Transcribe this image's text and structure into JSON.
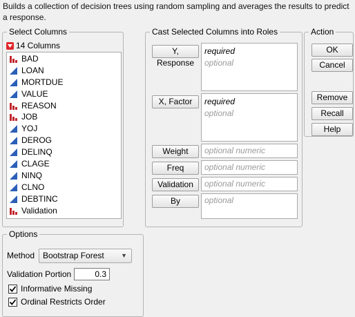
{
  "description": "Builds a collection of decision trees using random sampling and averages the results to predict a response.",
  "select_columns": {
    "title": "Select Columns",
    "count_label": "14 Columns",
    "items": [
      {
        "name": "BAD",
        "type": "nominal"
      },
      {
        "name": "LOAN",
        "type": "continuous"
      },
      {
        "name": "MORTDUE",
        "type": "continuous"
      },
      {
        "name": "VALUE",
        "type": "continuous"
      },
      {
        "name": "REASON",
        "type": "nominal"
      },
      {
        "name": "JOB",
        "type": "nominal"
      },
      {
        "name": "YOJ",
        "type": "continuous"
      },
      {
        "name": "DEROG",
        "type": "continuous"
      },
      {
        "name": "DELINQ",
        "type": "continuous"
      },
      {
        "name": "CLAGE",
        "type": "continuous"
      },
      {
        "name": "NINQ",
        "type": "continuous"
      },
      {
        "name": "CLNO",
        "type": "continuous"
      },
      {
        "name": "DEBTINC",
        "type": "continuous"
      },
      {
        "name": "Validation",
        "type": "nominal"
      }
    ]
  },
  "cast_roles": {
    "title": "Cast Selected Columns into Roles",
    "roles": [
      {
        "button": "Y, Response",
        "required": "required",
        "optional": "optional"
      },
      {
        "button": "X, Factor",
        "required": "required",
        "optional": "optional"
      },
      {
        "button": "Weight",
        "placeholder": "optional numeric"
      },
      {
        "button": "Freq",
        "placeholder": "optional numeric"
      },
      {
        "button": "Validation",
        "placeholder": "optional numeric"
      },
      {
        "button": "By",
        "placeholder": "optional"
      }
    ]
  },
  "action": {
    "title": "Action",
    "ok": "OK",
    "cancel": "Cancel",
    "remove": "Remove",
    "recall": "Recall",
    "help": "Help"
  },
  "options": {
    "title": "Options",
    "method_label": "Method",
    "method_value": "Bootstrap Forest",
    "validation_portion_label": "Validation Portion",
    "validation_portion_value": "0.3",
    "informative_missing_label": "Informative Missing",
    "informative_missing_checked": true,
    "ordinal_restricts_label": "Ordinal Restricts Order",
    "ordinal_restricts_checked": true
  },
  "colors": {
    "nominal_icon": "#c0282d",
    "continuous_icon": "#2b5fb8"
  }
}
